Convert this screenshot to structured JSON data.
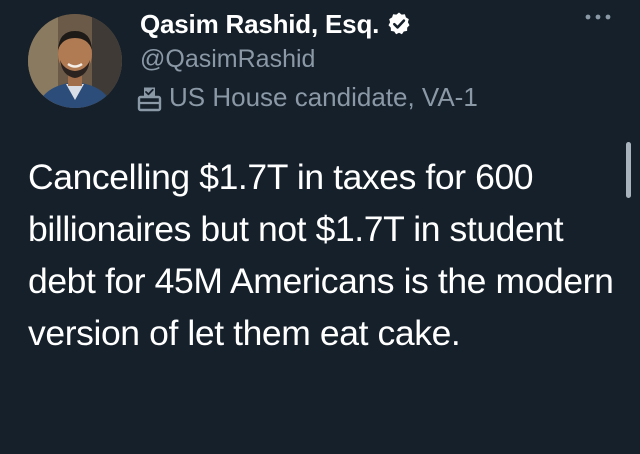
{
  "author": {
    "display_name": "Qasim Rashid, Esq.",
    "handle": "@QasimRashid",
    "verified": true,
    "label": "US House candidate, VA-1"
  },
  "tweet": {
    "text": "Cancelling $1.7T in taxes for 600 billionaires but not $1.7T in student debt for 45M Americans is the modern version of let them eat cake."
  },
  "icons": {
    "verified": "verified-badge-icon",
    "label": "ballot-box-icon",
    "more": "more-options-icon"
  },
  "colors": {
    "background": "#15202b",
    "primary_text": "#ffffff",
    "secondary_text": "#8b98a5"
  }
}
